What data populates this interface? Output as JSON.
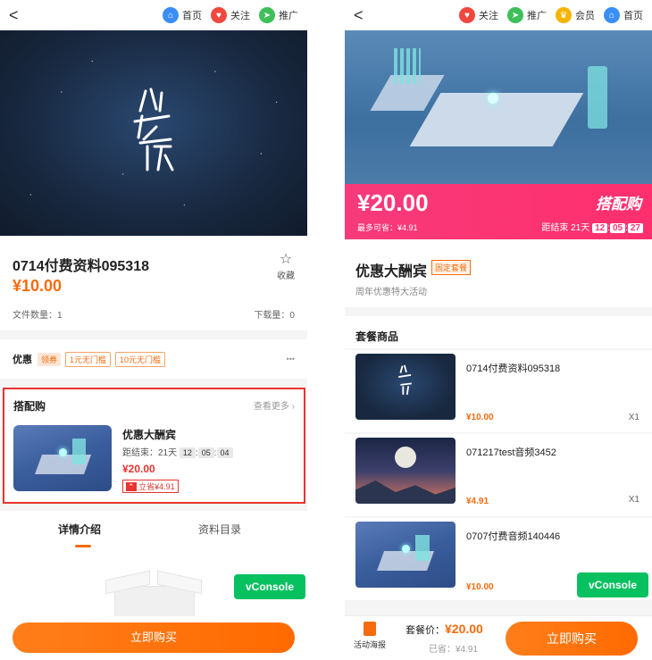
{
  "left": {
    "nav": {
      "back": "<",
      "items": [
        {
          "label": "首页",
          "icon": "home-icon",
          "color": "#3a8ef6"
        },
        {
          "label": "关注",
          "icon": "heart-icon",
          "color": "#f0483e"
        },
        {
          "label": "推广",
          "icon": "send-icon",
          "color": "#3fbf5a"
        }
      ]
    },
    "product": {
      "title": "0714付费资料095318",
      "price": "¥10.00",
      "favorite_label": "收藏",
      "file_count": "文件数量：1",
      "downloads": "下载量：0"
    },
    "discount": {
      "label": "优惠",
      "coupon_tag": "领券",
      "coupons": [
        "1元无门槛",
        "10元无门槛"
      ],
      "more": "•••"
    },
    "bundle": {
      "title": "搭配购",
      "more": "查看更多",
      "name": "优惠大酬宾",
      "countdown_label": "距结束：21天",
      "time": [
        "12",
        "05",
        "04"
      ],
      "price": "¥20.00",
      "save": "立省¥4.91"
    },
    "tabs": [
      "详情介绍",
      "资料目录"
    ],
    "vconsole": "vConsole",
    "buy_button": "立即购买"
  },
  "right": {
    "nav": {
      "back": "<",
      "items": [
        {
          "label": "关注",
          "icon": "heart-icon",
          "color": "#f0483e"
        },
        {
          "label": "推广",
          "icon": "send-icon",
          "color": "#3fbf5a"
        },
        {
          "label": "会员",
          "icon": "crown-icon",
          "color": "#f4b400"
        },
        {
          "label": "首页",
          "icon": "home-icon",
          "color": "#3a8ef6"
        }
      ]
    },
    "banner": {
      "price": "¥20.00",
      "max_save": "最多可省：¥4.91",
      "brand": "搭配购",
      "countdown_label": "距结束",
      "days": "21天",
      "time": [
        "12",
        "05",
        "27"
      ]
    },
    "bundle": {
      "name": "优惠大酬宾",
      "tag": "固定套餐",
      "subtitle": "周年优惠特大活动"
    },
    "section_title": "套餐商品",
    "items": [
      {
        "title": "0714付费资料095318",
        "price": "¥10.00",
        "qty": "X1"
      },
      {
        "title": "071217test音频3452",
        "price": "¥4.91",
        "qty": "X1"
      },
      {
        "title": "0707付费音频140446",
        "price": "¥10.00",
        "qty": ""
      }
    ],
    "vconsole": "vConsole",
    "footer": {
      "poster": "活动海报",
      "bundle_price_label": "套餐价：",
      "bundle_price": "¥20.00",
      "saved_label": "已省：",
      "saved": "¥4.91",
      "buy_button": "立即购买"
    }
  }
}
